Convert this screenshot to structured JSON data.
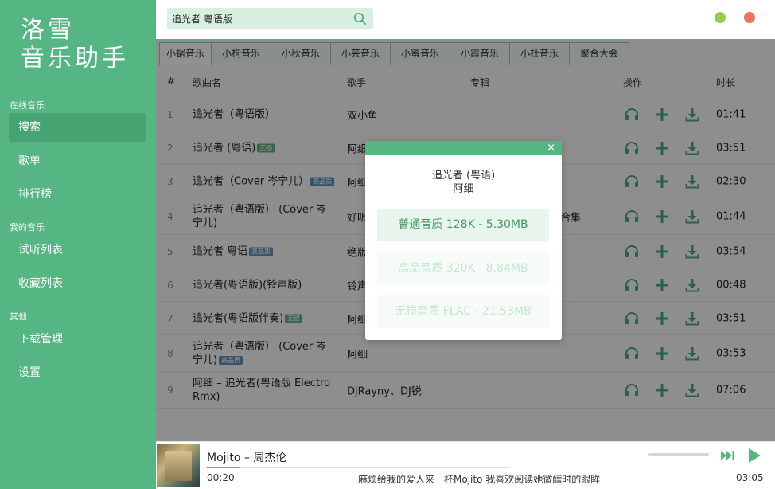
{
  "app": {
    "logo_line1": "洛雪",
    "logo_line2": "音乐助手"
  },
  "sidebar": {
    "section_online": "在线音乐",
    "section_mine": "我的音乐",
    "section_other": "其他",
    "items": {
      "search": "搜索",
      "playlist": "歌单",
      "charts": "排行榜",
      "listen_list": "试听列表",
      "favorites": "收藏列表",
      "downloads": "下载管理",
      "settings": "设置"
    }
  },
  "search": {
    "value": "追光者 粤语版",
    "placeholder": ""
  },
  "window": {
    "minimize_color": "#8fd14f",
    "close_color": "#f0735a"
  },
  "tabs": [
    "小蜗音乐",
    "小枸音乐",
    "小秋音乐",
    "小芸音乐",
    "小蜜音乐",
    "小霞音乐",
    "小杜音乐",
    "聚合大会"
  ],
  "table": {
    "headers": {
      "index": "#",
      "title": "歌曲名",
      "artist": "歌手",
      "album": "专辑",
      "ops": "操作",
      "duration": "时长"
    },
    "rows": [
      {
        "index": "1",
        "title": "追光者（粤语版）",
        "badge": "",
        "artist": "双小鱼",
        "album": "",
        "duration": "01:41"
      },
      {
        "index": "2",
        "title": "追光者 (粤语)",
        "badge": "无损",
        "artist": "阿细",
        "album": "",
        "duration": "03:51"
      },
      {
        "index": "3",
        "title": "追光者（Cover 岑宁儿）",
        "badge": "高品质",
        "artist": "阿细",
        "album": "",
        "duration": "02:30"
      },
      {
        "index": "4",
        "title": "追光者（粤语版） (Cover 岑宁儿)",
        "badge": "",
        "artist": "好听",
        "album": "合集",
        "duration": "01:44"
      },
      {
        "index": "5",
        "title": "追光者 粤语",
        "badge": "高品质",
        "artist": "绝版",
        "album": "",
        "duration": "03:54"
      },
      {
        "index": "6",
        "title": "追光者(粤语版)(铃声版)",
        "badge": "",
        "artist": "铃声",
        "album": "",
        "duration": "00:48"
      },
      {
        "index": "7",
        "title": "追光者(粤语版伴奏)",
        "badge": "无损",
        "artist": "阿细",
        "album": "",
        "duration": "03:51"
      },
      {
        "index": "8",
        "title": "追光者（粤语版） (Cover 岑宁儿)",
        "badge": "高品质",
        "artist": "阿细",
        "album": "",
        "duration": "03:53"
      },
      {
        "index": "9",
        "title": "阿细 – 追光者(粤语版 Electro Rmx)",
        "badge": "",
        "artist": "DjRayny、DJ锐",
        "album": "",
        "duration": "07:06"
      }
    ]
  },
  "modal": {
    "song": "追光者 (粤语)",
    "artist": "阿细",
    "close": "×",
    "options": [
      "普通音质 128K - 5.30MB",
      "高品音质 320K - 8.84MB",
      "无损音质 FLAC - 21.53MB"
    ]
  },
  "player": {
    "song": "Mojito – 周杰伦",
    "current_time": "00:20",
    "total_time": "03:05",
    "lyric": "麻烦给我的爱人来一杯Mojito 我喜欢阅读她微醺时的眼眸",
    "progress": 0.11,
    "accent": "#55b683"
  }
}
